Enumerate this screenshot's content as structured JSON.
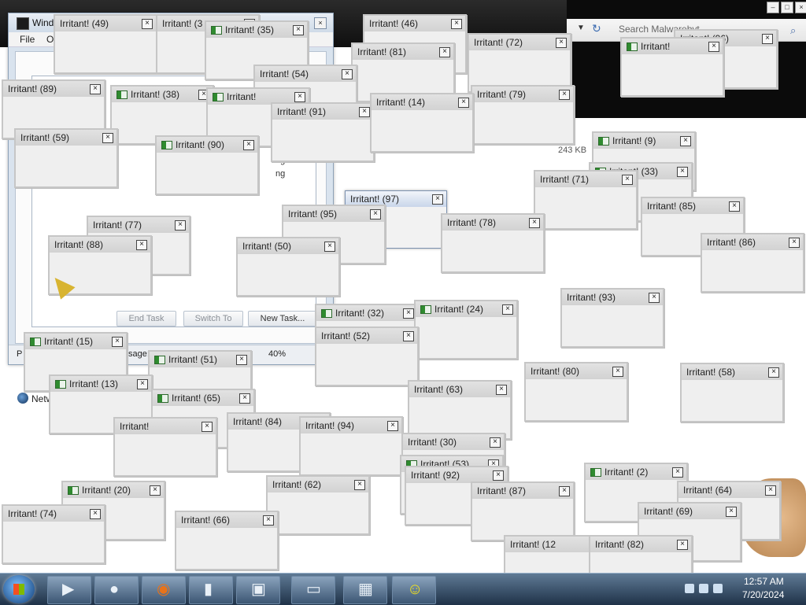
{
  "taskmgr": {
    "title": "Wind",
    "menu": {
      "file": "File",
      "options": "O"
    },
    "buttons": {
      "end_task": "End Task",
      "switch_to": "Switch To",
      "new_task": "New Task..."
    },
    "status": {
      "a": "P",
      "b": "sage: 30%",
      "c": "40%"
    },
    "size": "243 KB",
    "ng1": "ng",
    "ng2": "ng"
  },
  "malwarebytes": {
    "search_placeholder": "Search Malwarebyt..."
  },
  "desktop": {
    "network_label": "Netw"
  },
  "irritants": [
    {
      "title": "Irritant! (49)"
    },
    {
      "title": "Irritant! (3"
    },
    {
      "title": "Irritant! (35)"
    },
    {
      "title": "Irritant! (46)"
    },
    {
      "title": "Irritant! (81)"
    },
    {
      "title": "Irritant! (72)"
    },
    {
      "title": "Irritant! (96)"
    },
    {
      "title": "Irritant!"
    },
    {
      "title": "Irritant! (54)"
    },
    {
      "title": "Irritant! (89)"
    },
    {
      "title": "Irritant! (38)"
    },
    {
      "title": "Irritant!"
    },
    {
      "title": "Irritant! (91)"
    },
    {
      "title": "Irritant! (79)"
    },
    {
      "title": "Irritant! (14)"
    },
    {
      "title": "Irritant! (9)"
    },
    {
      "title": "Irritant! (90)"
    },
    {
      "title": "Irritant! (59)"
    },
    {
      "title": "Irritant! (33)"
    },
    {
      "title": "Irritant! (71)"
    },
    {
      "title": "Irritant! (97)"
    },
    {
      "title": "Irritant! (95)"
    },
    {
      "title": "Irritant! (85)"
    },
    {
      "title": "Irritant! (77)"
    },
    {
      "title": "Irritant! (78)"
    },
    {
      "title": "Irritant! (86)"
    },
    {
      "title": "Irritant! (88)"
    },
    {
      "title": "Irritant! (50)"
    },
    {
      "title": "Irritant! (93)"
    },
    {
      "title": "Irritant! (32)"
    },
    {
      "title": "Irritant! (24)"
    },
    {
      "title": "Irritant! (52)"
    },
    {
      "title": "Irritant! (15)"
    },
    {
      "title": "Irritant! (51)"
    },
    {
      "title": "Irritant! (80)"
    },
    {
      "title": "Irritant! (58)"
    },
    {
      "title": "Irritant! (13)"
    },
    {
      "title": "Irritant! (65)"
    },
    {
      "title": "Irritant! (63)"
    },
    {
      "title": "Irritant!"
    },
    {
      "title": "Irritant! (84)"
    },
    {
      "title": "Irritant! (94)"
    },
    {
      "title": "Irritant! (30)"
    },
    {
      "title": "Irritant! (53)"
    },
    {
      "title": "Irritant! (2)"
    },
    {
      "title": "Irritant! (20)"
    },
    {
      "title": "Irritant! (62)"
    },
    {
      "title": "Irritant! (92)"
    },
    {
      "title": "Irritant! (87)"
    },
    {
      "title": "Irritant! (64)"
    },
    {
      "title": "Irritant! (74)"
    },
    {
      "title": "Irritant! (66)"
    },
    {
      "title": "Irritant! (69)"
    },
    {
      "title": "Irritant! (12"
    },
    {
      "title": "Irritant! (82)"
    }
  ],
  "taskbar": {
    "buttons": [
      {
        "icon": "media-player-icon"
      },
      {
        "icon": "network-globe-icon"
      },
      {
        "icon": "firefox-icon"
      },
      {
        "icon": "terminal-icon"
      },
      {
        "icon": "zip-icon"
      },
      {
        "icon": "monitor-icon"
      },
      {
        "icon": "task-manager-icon"
      },
      {
        "icon": "smiley-icon"
      }
    ],
    "time": "12:57 AM",
    "date": "7/20/2024"
  }
}
